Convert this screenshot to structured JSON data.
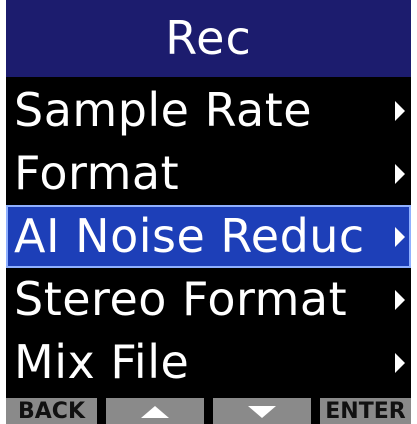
{
  "header": {
    "title": "Rec"
  },
  "menu": {
    "items": [
      {
        "label": "Sample Rate",
        "selected": false,
        "icon": "chevron-right-icon"
      },
      {
        "label": "Format",
        "selected": false,
        "icon": "chevron-right-icon"
      },
      {
        "label": "AI Noise Reduc",
        "selected": true,
        "icon": "chevron-right-icon"
      },
      {
        "label": "Stereo Format",
        "selected": false,
        "icon": "chevron-right-icon"
      },
      {
        "label": "Mix File",
        "selected": false,
        "icon": "chevron-right-icon"
      }
    ]
  },
  "softkeys": {
    "back_label": "BACK",
    "up_icon": "triangle-up-icon",
    "down_icon": "triangle-down-icon",
    "enter_label": "ENTER"
  },
  "colors": {
    "title_bar": "#1c1c6e",
    "selected_item": "#1d3fb8",
    "screen_background": "#000000",
    "softkey_background": "#8a8a8a"
  }
}
